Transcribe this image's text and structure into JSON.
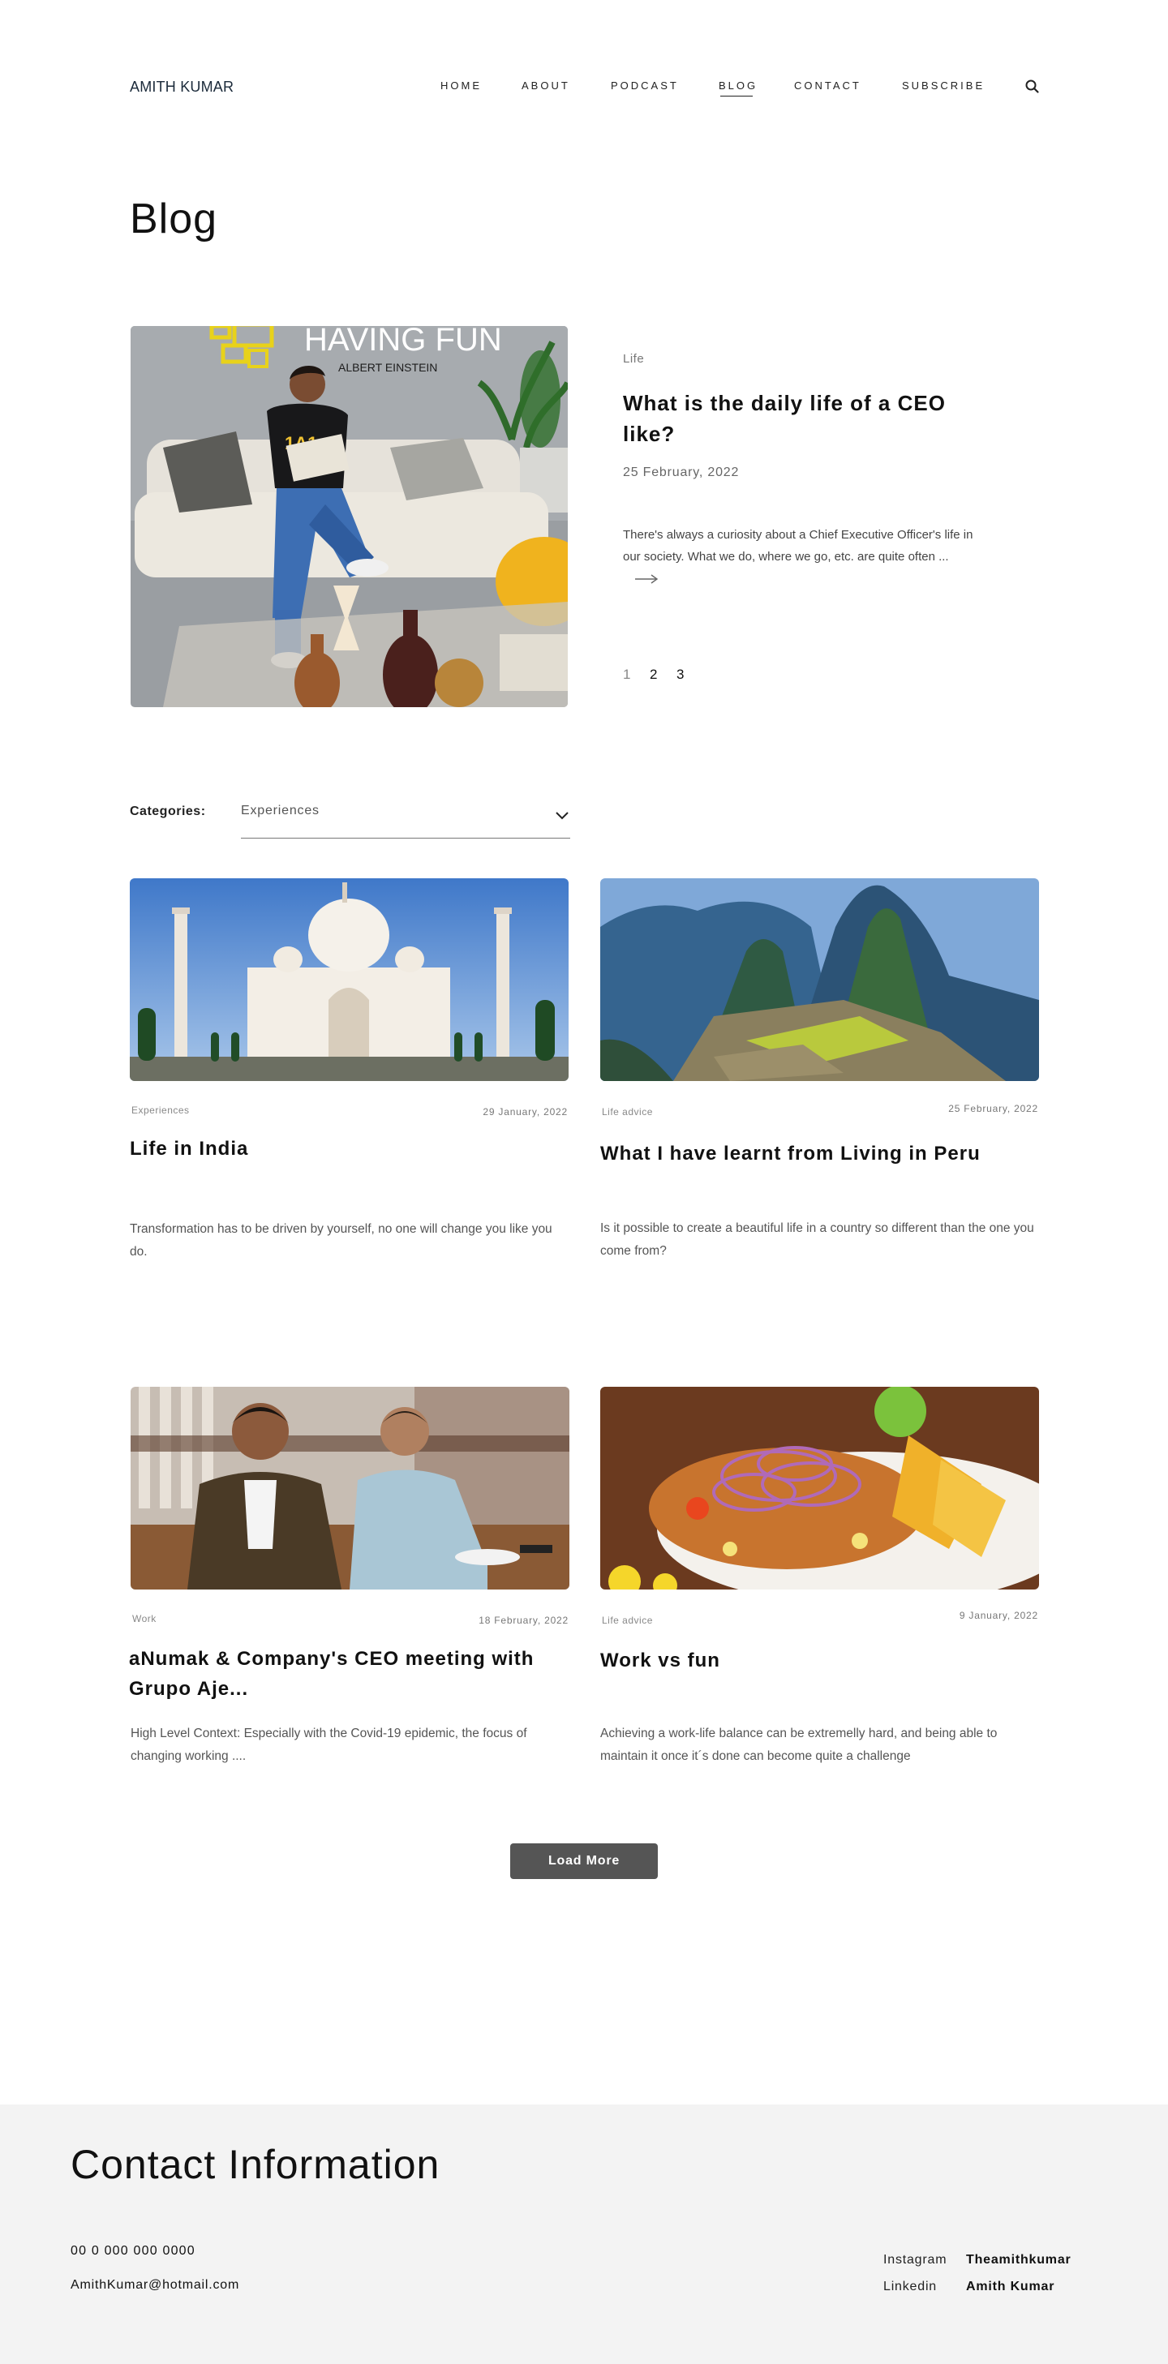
{
  "header": {
    "logo": "AMITH KUMAR",
    "nav": [
      "HOME",
      "ABOUT",
      "PODCAST",
      "BLOG",
      "CONTACT",
      "SUBSCRIBE"
    ],
    "active_nav": "BLOG",
    "search_icon": "search-icon"
  },
  "page": {
    "title": "Blog"
  },
  "featured": {
    "category": "Life",
    "title": "What is the daily life of a CEO like?",
    "date": "25 February, 2022",
    "excerpt": "There's always a curiosity about a Chief Executive Officer's life in our society. What we do, where we go, etc. are quite often ...",
    "image_alt": "Man reading on a sofa under a HAVING FUN ALBERT EINSTEIN wall sign",
    "image_sign_line1": "HAVING FUN",
    "image_sign_line2": "ALBERT EINSTEIN",
    "image_shirt_text": "1A1",
    "pages": [
      "1",
      "2",
      "3"
    ],
    "current_page": "1"
  },
  "categories": {
    "label": "Categories:",
    "selected": "Experiences"
  },
  "posts": [
    {
      "category": "Experiences",
      "date": "29 January, 2022",
      "title": "Life in India",
      "excerpt": "Transformation has to be driven by yourself, no one will change you like you do.",
      "image": "taj-mahal"
    },
    {
      "category": "Life advice",
      "date": "25 February, 2022",
      "title": "What I have learnt from Living in Peru",
      "excerpt": "Is it possible to create a beautiful life in a country so different than the one you come from?",
      "image": "machu-picchu"
    },
    {
      "category": "Work",
      "date": "18 February, 2022",
      "title": "aNumak & Company's CEO meeting with Grupo Aje...",
      "excerpt": "High Level Context: Especially with the Covid-19 epidemic, the focus of changing working ....",
      "image": "meeting"
    },
    {
      "category": "Life advice",
      "date": "9 January, 2022",
      "title": "Work vs fun",
      "excerpt": "Achieving a work-life balance can be extremelly hard, and being able to maintain it once it´s done can become quite a challenge",
      "image": "ceviche"
    }
  ],
  "load_more": "Load More",
  "footer": {
    "title": "Contact Information",
    "phone": "00 0 000 000 0000",
    "email": "AmithKumar@hotmail.com",
    "social": [
      {
        "label": "Instagram",
        "value": "Theamithkumar"
      },
      {
        "label": "Linkedin",
        "value": "Amith Kumar"
      }
    ]
  },
  "colors": {
    "text": "#111111",
    "muted": "#777777",
    "button": "#555555",
    "footer_bg": "#f3f3f3"
  }
}
